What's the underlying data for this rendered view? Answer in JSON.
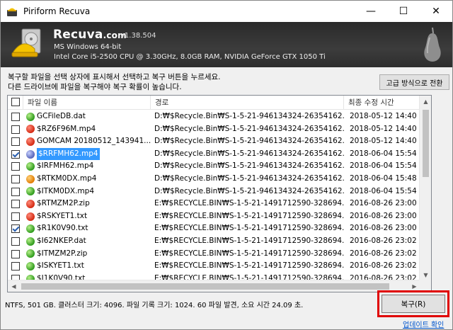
{
  "window": {
    "title": "Piriform Recuva",
    "minimize": "—",
    "maximize": "☐",
    "close": "✕"
  },
  "header": {
    "brand": "Recuva",
    "brand_suffix": ".com",
    "version": "v1.38.504",
    "os": "MS Windows 64-bit",
    "hardware": "Intel Core i5-2500 CPU @ 3.30GHz, 8.0GB RAM, NVIDIA GeForce GTX 1050 Ti"
  },
  "instructions": {
    "line1": "복구할 파일을 선택 상자에 표시해서 선택하고 복구 버튼을 누르세요.",
    "line2": "다른 드라이브에 파일을 복구해야 복구 확률이 높습니다."
  },
  "advanced_button": "고급 방식으로 전환",
  "table": {
    "columns": [
      "파일 이름",
      "경로",
      "최종 수정 시간"
    ],
    "rows": [
      {
        "checked": false,
        "state": "green",
        "name": "GCFileDB.dat",
        "path": "D:₩$Recycle.Bin₩S-1-5-21-946134324-26354162...",
        "date": "2018-05-12 14:40",
        "selected": false
      },
      {
        "checked": false,
        "state": "red",
        "name": "$RZ6F96M.mp4",
        "path": "D:₩$Recycle.Bin₩S-1-5-21-946134324-26354162...",
        "date": "2018-05-12 14:40",
        "selected": false
      },
      {
        "checked": false,
        "state": "red",
        "name": "GOMCAM 20180512_143941...",
        "path": "D:₩$Recycle.Bin₩S-1-5-21-946134324-26354162...",
        "date": "2018-05-12 14:40",
        "selected": false
      },
      {
        "checked": true,
        "state": "blue",
        "name": "$RRFMH62.mp4",
        "path": "D:₩$Recycle.Bin₩S-1-5-21-946134324-26354162...",
        "date": "2018-06-04 15:54",
        "selected": true
      },
      {
        "checked": false,
        "state": "green",
        "name": "$IRFMH62.mp4",
        "path": "D:₩$Recycle.Bin₩S-1-5-21-946134324-26354162...",
        "date": "2018-06-04 15:54",
        "selected": false
      },
      {
        "checked": false,
        "state": "orange",
        "name": "$RTKM0DX.mp4",
        "path": "D:₩$Recycle.Bin₩S-1-5-21-946134324-26354162...",
        "date": "2018-06-04 15:48",
        "selected": false
      },
      {
        "checked": false,
        "state": "green",
        "name": "$ITKM0DX.mp4",
        "path": "D:₩$Recycle.Bin₩S-1-5-21-946134324-26354162...",
        "date": "2018-06-04 15:54",
        "selected": false
      },
      {
        "checked": false,
        "state": "red",
        "name": "$RTMZM2P.zip",
        "path": "E:₩$RECYCLE.BIN₩S-1-5-21-1491712590-328694...",
        "date": "2016-08-26 23:00",
        "selected": false
      },
      {
        "checked": false,
        "state": "red",
        "name": "$RSKYET1.txt",
        "path": "E:₩$RECYCLE.BIN₩S-1-5-21-1491712590-328694...",
        "date": "2016-08-26 23:00",
        "selected": false
      },
      {
        "checked": true,
        "state": "green",
        "name": "$R1K0V90.txt",
        "path": "E:₩$RECYCLE.BIN₩S-1-5-21-1491712590-328694...",
        "date": "2016-08-26 23:00",
        "selected": false
      },
      {
        "checked": false,
        "state": "green",
        "name": "$I62NKEP.dat",
        "path": "E:₩$RECYCLE.BIN₩S-1-5-21-1491712590-328694...",
        "date": "2016-08-26 23:02",
        "selected": false
      },
      {
        "checked": false,
        "state": "green",
        "name": "$ITMZM2P.zip",
        "path": "E:₩$RECYCLE.BIN₩S-1-5-21-1491712590-328694...",
        "date": "2016-08-26 23:02",
        "selected": false
      },
      {
        "checked": false,
        "state": "green",
        "name": "$ISKYET1.txt",
        "path": "E:₩$RECYCLE.BIN₩S-1-5-21-1491712590-328694...",
        "date": "2016-08-26 23:02",
        "selected": false
      },
      {
        "checked": false,
        "state": "green",
        "name": "$I1K0V90.txt",
        "path": "E:₩$RECYCLE.BIN₩S-1-5-21-1491712590-328694...",
        "date": "2016-08-26 23:02",
        "selected": false
      }
    ]
  },
  "status_text": "NTFS, 501 GB. 클러스터 크기: 4096. 파일 기록 크기: 1024. 60 파일 발견, 소요 시간 24.09 초.",
  "recover_button": "복구(R)",
  "update_link": "업데이트 확인",
  "colors": {
    "highlight_outline": "#e00000",
    "selection": "#3399ff",
    "link": "#0055cc"
  }
}
